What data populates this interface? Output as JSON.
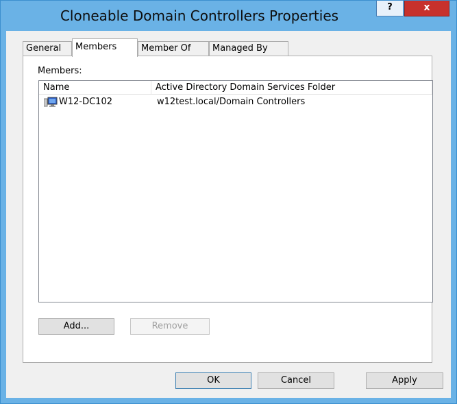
{
  "window": {
    "title": "Cloneable Domain Controllers Properties",
    "help_glyph": "?",
    "close_glyph": "x"
  },
  "tabs": [
    {
      "label": "General",
      "active": false
    },
    {
      "label": "Members",
      "active": true
    },
    {
      "label": "Member Of",
      "active": false
    },
    {
      "label": "Managed By",
      "active": false
    }
  ],
  "members": {
    "label": "Members:",
    "columns": [
      "Name",
      "Active Directory Domain Services Folder"
    ],
    "rows": [
      {
        "icon": "computer-icon",
        "name": "W12-DC102",
        "folder": "w12test.local/Domain Controllers"
      }
    ],
    "add_label": "Add...",
    "remove_label": "Remove"
  },
  "dialog_buttons": {
    "ok": "OK",
    "cancel": "Cancel",
    "apply": "Apply"
  },
  "colors": {
    "frame": "#6ab2e6",
    "close": "#c7312c",
    "client": "#f0f0f0"
  }
}
